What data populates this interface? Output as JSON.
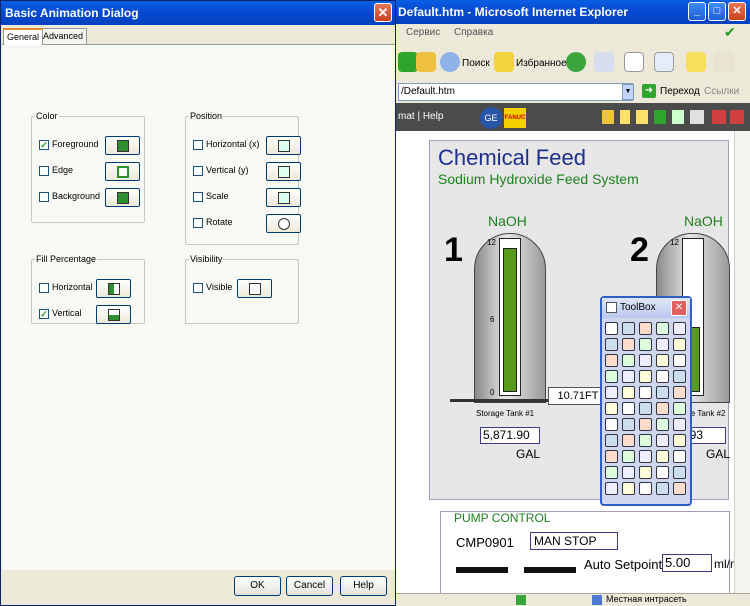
{
  "dialog": {
    "title": "Basic Animation Dialog",
    "tabs": [
      {
        "label": "General",
        "active": true
      },
      {
        "label": "Advanced",
        "active": false
      }
    ],
    "color_group": {
      "legend": "Color",
      "items": [
        {
          "label": "Foreground",
          "checked": true
        },
        {
          "label": "Edge",
          "checked": false
        },
        {
          "label": "Background",
          "checked": false
        }
      ]
    },
    "position_group": {
      "legend": "Position",
      "items": [
        {
          "label": "Horizontal (x)",
          "checked": false
        },
        {
          "label": "Vertical (y)",
          "checked": false
        },
        {
          "label": "Scale",
          "checked": false
        },
        {
          "label": "Rotate",
          "checked": false
        }
      ]
    },
    "fill_group": {
      "legend": "Fill Percentage",
      "items": [
        {
          "label": "Horizontal",
          "checked": false
        },
        {
          "label": "Vertical",
          "checked": true
        }
      ]
    },
    "visibility_group": {
      "legend": "Visibility",
      "items": [
        {
          "label": "Visible",
          "checked": false
        }
      ]
    },
    "buttons": {
      "ok": "OK",
      "cancel": "Cancel",
      "help": "Help"
    }
  },
  "ie": {
    "title": "Default.htm - Microsoft Internet Explorer",
    "menu": {
      "service": "Сервис",
      "help": "Справка"
    },
    "toolbar": {
      "search": "Поиск",
      "favorites": "Избранное"
    },
    "address": {
      "value": "/Default.htm",
      "go": "Переход",
      "links": "Ссылки"
    },
    "app_bar_text": "mat | Help",
    "ge_logo": "GE",
    "fanuc_logo": "FANUC",
    "status_zone": "Местная интрасеть"
  },
  "hmi": {
    "title": "Chemical Feed",
    "subtitle": "Sodium Hydroxide Feed System",
    "tank1": {
      "number": "1",
      "chemical": "NaOH",
      "label": "Storage Tank #1",
      "value": "5,871.90",
      "unit": "GAL",
      "scale_max": "12",
      "scale_mid": "6",
      "scale_min": "0",
      "level_fraction": 0.96
    },
    "tank2": {
      "number": "2",
      "chemical": "NaOH",
      "label": "age Tank #2",
      "value": "94.93",
      "unit": "GAL",
      "scale_max": "12",
      "level_fraction": 0.43
    },
    "pipe_readout": "10.71FT",
    "pump": {
      "title": "PUMP CONTROL",
      "id": "CMP0901",
      "mode": "MAN STOP",
      "setpoint_label": "Auto Setpoint",
      "setpoint_value": "5.00",
      "setpoint_unit": "ml/m"
    }
  },
  "toolbox": {
    "title": "ToolBox"
  },
  "colors": {
    "title_blue": "#0449d0",
    "hmi_blue": "#1f2f8f",
    "hmi_green": "#1f7f1f",
    "level_green": "#5b9b1b"
  }
}
